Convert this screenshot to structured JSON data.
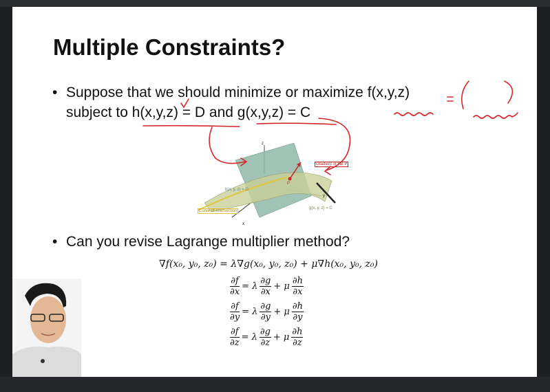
{
  "slide": {
    "title": "Multiple Constraints?",
    "bullet1_line1": "Suppose that we should minimize or maximize f(x,y,z)",
    "bullet1_line2": "subject to h(x,y,z) = D and g(x,y,z) = C",
    "bullet2": "Can you revise Lagrange multiplier method?"
  },
  "figure": {
    "axis_z": "z",
    "axis_y": "y",
    "axis_x": "x",
    "point_label": "P",
    "gradient_label": "Gradient of f at P",
    "h_label": "h(x, y, z) = D",
    "g_label": "g(x, y, z) = C",
    "curve_label": "Curve of Intersection"
  },
  "equations": {
    "main": "∇f(x₀, y₀, z₀) = λ∇g(x₀, y₀, z₀) + μ∇h(x₀, y₀, z₀)",
    "rows": [
      {
        "df": "∂f",
        "dv": "∂x",
        "dg": "∂g",
        "dh": "∂h"
      },
      {
        "df": "∂f",
        "dv": "∂y",
        "dg": "∂g",
        "dh": "∂h"
      },
      {
        "df": "∂f",
        "dv": "∂z",
        "dg": "∂g",
        "dh": "∂h"
      }
    ],
    "eq_sign": "= λ",
    "plus_mu": "+ μ"
  },
  "colors": {
    "ink": "#d62828",
    "plane": "#8fb8a8",
    "surface": "#c9cf9a",
    "curve": "#e2c53a"
  }
}
